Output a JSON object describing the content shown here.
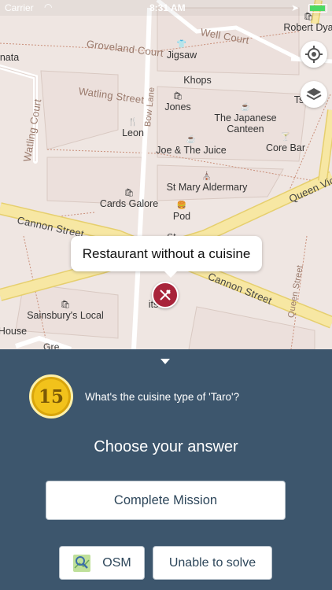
{
  "statusbar": {
    "carrier": "Carrier",
    "time": "8:31 AM"
  },
  "map": {
    "streets": [
      "Groveland Court",
      "Well Court",
      "Watling Street",
      "Watling Court",
      "Bow Lane",
      "Cannon Street",
      "Cannon Street",
      "Queen Victoria St",
      "Queen Street",
      "ra St",
      "Gre"
    ],
    "pois": [
      {
        "name": "Robert Dya",
        "icon": "shop"
      },
      {
        "name": "nata",
        "icon": ""
      },
      {
        "name": "Jigsaw",
        "icon": "clothes"
      },
      {
        "name": "Khops",
        "icon": ""
      },
      {
        "name": "Jones",
        "icon": "shop"
      },
      {
        "name": "The Japanese Canteen",
        "icon": "cafe"
      },
      {
        "name": "Leon",
        "icon": "restaurant"
      },
      {
        "name": "Joe & The Juice",
        "icon": "cafe"
      },
      {
        "name": "Core Bar",
        "icon": "bar"
      },
      {
        "name": "St Mary Aldermary",
        "icon": "church"
      },
      {
        "name": "Cards Galore",
        "icon": "shop"
      },
      {
        "name": "Pod",
        "icon": "fastfood"
      },
      {
        "name": "Sainsbury's Local",
        "icon": "shop"
      },
      {
        "name": "House",
        "icon": ""
      },
      {
        "name": "its",
        "icon": ""
      },
      {
        "name": "Ts",
        "icon": ""
      }
    ],
    "callout": "Restaurant without a cuisine"
  },
  "quest": {
    "points": "15",
    "question": "What's the cuisine type of 'Taro'?",
    "prompt": "Choose your answer",
    "complete_label": "Complete Mission",
    "osm_label": "OSM",
    "unable_label": "Unable to solve"
  },
  "colors": {
    "panel": "#3d566d",
    "pin": "#a8243a",
    "coin": "#f2c21b",
    "road_major": "#f7e7a3"
  }
}
